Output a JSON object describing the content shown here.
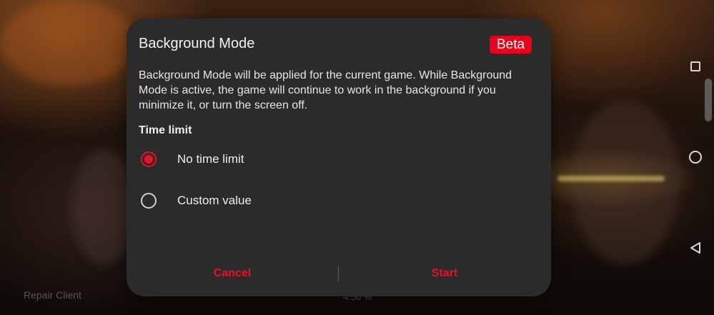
{
  "background": {
    "repair_client_label": "Repair Client",
    "progress_text": "4.50 %"
  },
  "dialog": {
    "title": "Background Mode",
    "badge": "Beta",
    "description": "Background Mode will be applied for the current game. While Background Mode is active, the game will continue to work in the background if you minimize it, or turn the screen off.",
    "section_label": "Time limit",
    "options": [
      {
        "label": "No time limit",
        "selected": true
      },
      {
        "label": "Custom value",
        "selected": false
      }
    ],
    "cancel_label": "Cancel",
    "start_label": "Start"
  },
  "colors": {
    "accent": "#e8102a",
    "badge": "#e8001c",
    "dialog_bg": "#2b2b2b"
  },
  "nav": {
    "icons": [
      "recents-square-icon",
      "home-circle-icon",
      "back-triangle-icon"
    ]
  }
}
